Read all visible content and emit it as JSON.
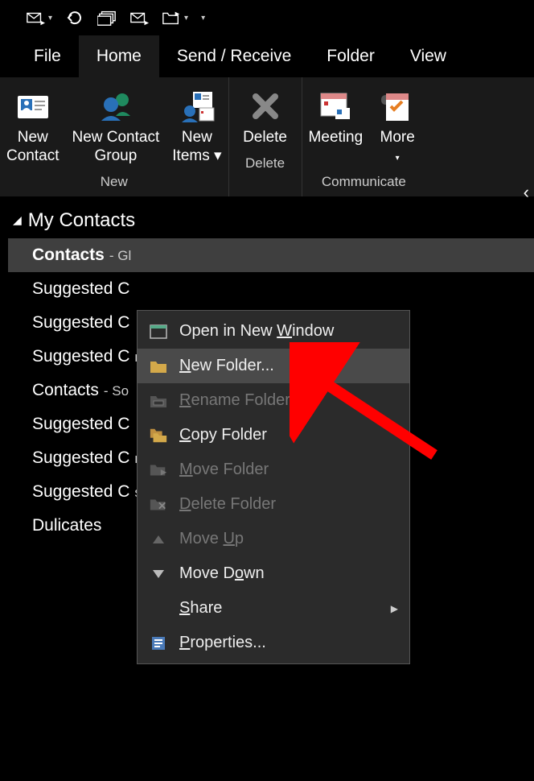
{
  "qat": {
    "items": [
      "send-receive-icon",
      "undo-icon",
      "items-icon",
      "mail-icon",
      "folder-icon"
    ]
  },
  "tabs": {
    "file": "File",
    "home": "Home",
    "send_receive": "Send / Receive",
    "folder": "Folder",
    "view": "View"
  },
  "ribbon": {
    "new_group": {
      "new_contact": "New\nContact",
      "new_contact_group": "New Contact\nGroup",
      "new_items": "New\nItems",
      "label": "New"
    },
    "delete_group": {
      "delete": "Delete",
      "label": "Delete"
    },
    "communicate_group": {
      "meeting": "Meeting",
      "more": "More",
      "label": "Communicate"
    }
  },
  "folders": {
    "header": "My Contacts",
    "items": [
      {
        "name": "Contacts",
        "suffix": "- Gl",
        "bold": true,
        "selected": true
      },
      {
        "name": "Suggested C",
        "suffix": ""
      },
      {
        "name": "Suggested C",
        "suffix": ""
      },
      {
        "name": "Suggested C",
        "suffix": "ne"
      },
      {
        "name": "Contacts",
        "suffix": "- So"
      },
      {
        "name": "Suggested C",
        "suffix": ""
      },
      {
        "name": "Suggested C",
        "suffix": "mailtooutlook.org"
      },
      {
        "name": "Suggested C",
        "suffix": "sfer.com"
      },
      {
        "name": "Dulicates",
        "suffix": ""
      }
    ]
  },
  "context_menu": {
    "open_new_window": {
      "pre": "Open in New ",
      "ul": "W",
      "post": "indow"
    },
    "new_folder": {
      "pre": "",
      "ul": "N",
      "post": "ew Folder..."
    },
    "rename_folder": {
      "pre": "",
      "ul": "R",
      "post": "ename Folder"
    },
    "copy_folder": {
      "pre": "",
      "ul": "C",
      "post": "opy Folder"
    },
    "move_folder": {
      "pre": "",
      "ul": "M",
      "post": "ove Folder"
    },
    "delete_folder": {
      "pre": "",
      "ul": "D",
      "post": "elete Folder"
    },
    "move_up": {
      "pre": "Move ",
      "ul": "U",
      "post": "p"
    },
    "move_down": {
      "pre": "Move D",
      "ul": "o",
      "post": "wn"
    },
    "share": {
      "pre": "",
      "ul": "S",
      "post": "hare"
    },
    "properties": {
      "pre": "",
      "ul": "P",
      "post": "roperties..."
    }
  }
}
